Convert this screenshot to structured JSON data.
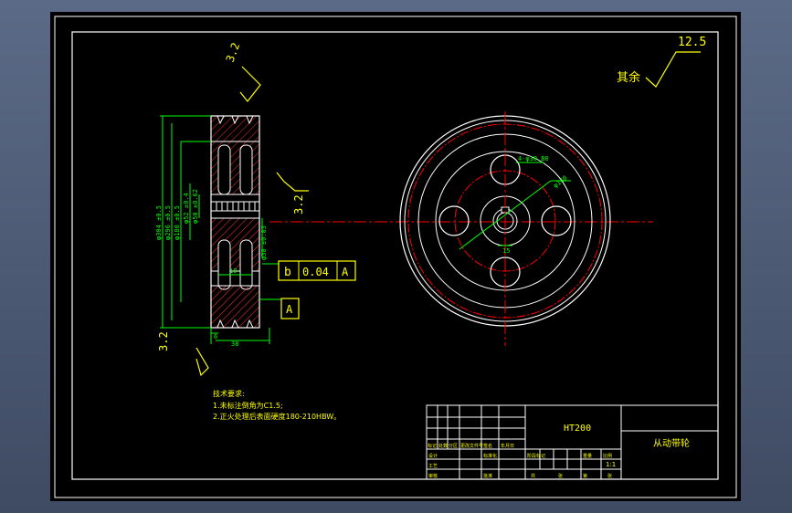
{
  "roughness": {
    "general_symbol_value": "12.5",
    "general_label": "其余",
    "value_1": "3.2",
    "value_2": "3.2",
    "value_3": "3.2"
  },
  "dimensions": {
    "d1": "φ304 ±0.5",
    "d2": "φ296 ±0.5",
    "d3": "φ180 ±0.5",
    "d4": "φ52 ±0.4",
    "d5": "φ50 ±0.62",
    "bore": "φ30 ±0.03",
    "width": "38",
    "hub": "10",
    "small": "6",
    "holes": "4-φ30 B0",
    "pcd": "φ140",
    "keyway": "15"
  },
  "tolerance": {
    "symbol": "b",
    "value": "0.04",
    "datum": "A"
  },
  "datum_label": "A",
  "notes": {
    "title": "技术要求:",
    "line1": "1.未标注倒角为C1.5;",
    "line2": "2.正火处理后表面硬度180-210HBW。"
  },
  "title_block": {
    "material": "HT200",
    "part_name": "从动带轮",
    "scale": "1:1",
    "c_biaoji": "标记",
    "c_chushu": "处数",
    "c_fenqu": "分区",
    "c_gengwenjian": "更改文件号",
    "c_qianming": "签名",
    "c_nianyueri": "年月日",
    "c_sheji": "设计",
    "c_biaozhunhua": "标准化",
    "c_jieduanbiaoji": "阶段标记",
    "c_zhongliang": "重量",
    "c_bili": "比例",
    "c_shenhe": "审核",
    "c_gongyi": "工艺",
    "c_pizhun": "批准",
    "c_gong": "共",
    "c_zhang1": "张",
    "c_di": "第",
    "c_zhang2": "张"
  },
  "colors": {
    "outline": "#ffffff",
    "dim": "#00ff00",
    "center": "#ff0000",
    "hatch": "#ff3030",
    "text": "#ffff00",
    "canvas": "#000000"
  }
}
